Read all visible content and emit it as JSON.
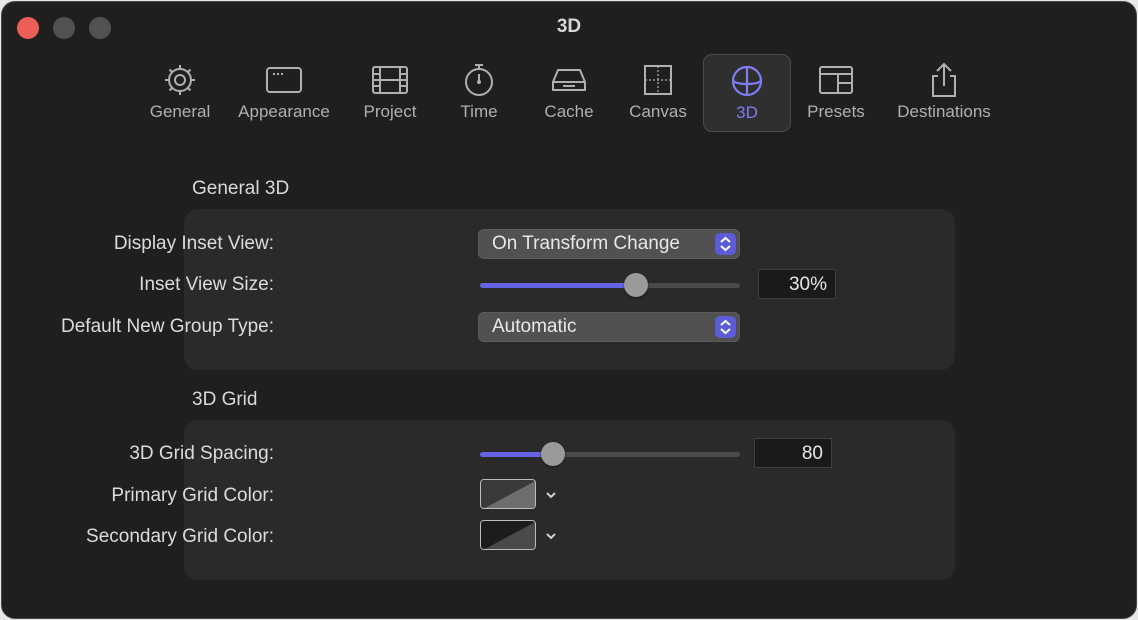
{
  "window": {
    "title": "3D"
  },
  "toolbar": {
    "items": [
      {
        "label": "General",
        "icon": "gear-icon"
      },
      {
        "label": "Appearance",
        "icon": "window-icon"
      },
      {
        "label": "Project",
        "icon": "film-icon"
      },
      {
        "label": "Time",
        "icon": "stopwatch-icon"
      },
      {
        "label": "Cache",
        "icon": "drive-icon"
      },
      {
        "label": "Canvas",
        "icon": "canvas-icon"
      },
      {
        "label": "3D",
        "icon": "globe-icon",
        "selected": true
      },
      {
        "label": "Presets",
        "icon": "presets-icon"
      },
      {
        "label": "Destinations",
        "icon": "share-icon"
      }
    ]
  },
  "general3d": {
    "title": "General 3D",
    "display_inset_view": {
      "label": "Display Inset View:",
      "value": "On Transform Change"
    },
    "inset_view_size": {
      "label": "Inset View Size:",
      "value": "30%",
      "slider_fraction": 0.6
    },
    "default_group_type": {
      "label": "Default New Group Type:",
      "value": "Automatic"
    }
  },
  "grid3d": {
    "title": "3D Grid",
    "spacing": {
      "label": "3D Grid Spacing:",
      "value": "80",
      "slider_fraction": 0.28
    },
    "primary_color": {
      "label": "Primary Grid Color:",
      "swatch": [
        "#6e6e6e",
        "#3a3a3a"
      ]
    },
    "secondary_color": {
      "label": "Secondary Grid Color:",
      "swatch": [
        "#4a4a4a",
        "#1c1c1c"
      ]
    }
  },
  "colors": {
    "accent": "#7f7cf5",
    "slider_fill": "#6562e3",
    "stepper": "#5c5cd6",
    "close": "#ed5f56"
  }
}
